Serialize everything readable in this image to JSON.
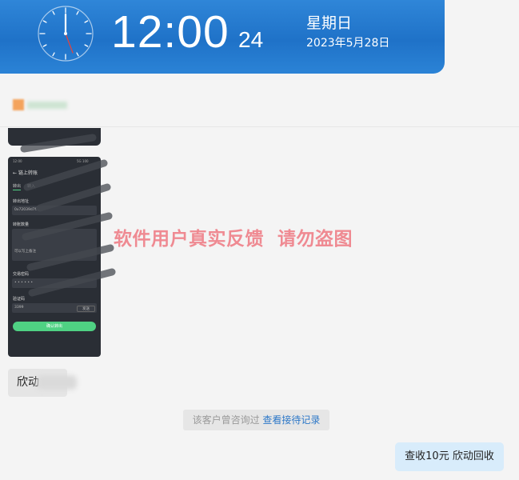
{
  "header": {
    "time": "12:00",
    "seconds": "24",
    "weekday": "星期日",
    "date": "2023年5月28日"
  },
  "watermark": "软件用户真实反馈  请勿盗图",
  "phone": {
    "status_left": "12:00",
    "status_right": "5G 100",
    "nav_title": "链上转账",
    "tab_out": "转出",
    "tab_in": "转入",
    "address_label": "转出地址",
    "address_value": "0x72039d7f...",
    "amount_label": "转账数量",
    "note_placeholder": "可以写上备注",
    "password_label": "交易密码",
    "password_value": "• • • • • •",
    "code_label": "验证码",
    "code_value": "3399",
    "code_button": "发送",
    "confirm_button": "确认转出"
  },
  "messages": {
    "left_bubble": "欣动",
    "notice_text": "该客户曾咨询过",
    "notice_link": "查看接待记录",
    "right_bubble": "查收10元 欣动回收"
  }
}
